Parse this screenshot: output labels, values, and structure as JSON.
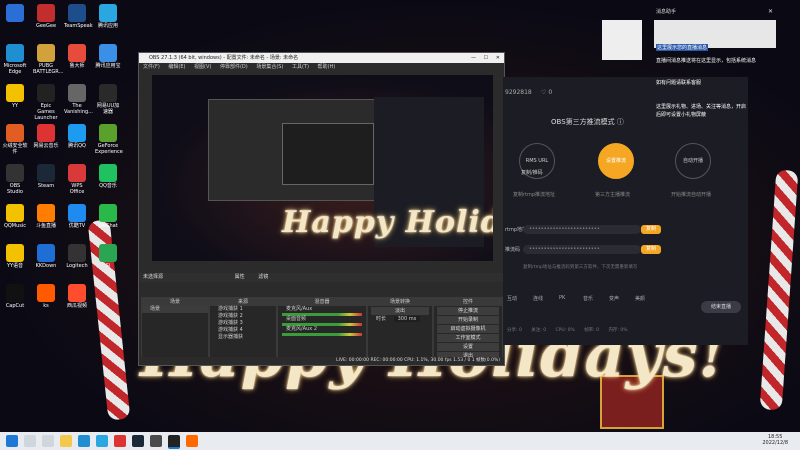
{
  "desktop": {
    "icons": [
      {
        "label": "",
        "color": "#2b6fd6"
      },
      {
        "label": "GeeGee",
        "color": "#c22d2d"
      },
      {
        "label": "TeamSpeak",
        "color": "#1e4d8c"
      },
      {
        "label": "腾讯应用",
        "color": "#2aa6e0"
      },
      {
        "label": "Microsoft Edge",
        "color": "#1f8fd1"
      },
      {
        "label": "PUBG BATTLEGR...",
        "color": "#d1a13b"
      },
      {
        "label": "鲁大师",
        "color": "#e64b3b"
      },
      {
        "label": "腾讯应用宝",
        "color": "#3b8fe6"
      },
      {
        "label": "YY",
        "color": "#f2c200"
      },
      {
        "label": "Epic Games Launcher",
        "color": "#222"
      },
      {
        "label": "The Vanishing...",
        "color": "#666"
      },
      {
        "label": "网易UU加速器",
        "color": "#2a2a2a"
      },
      {
        "label": "火绒安全软件",
        "color": "#e25d21"
      },
      {
        "label": "网易云音乐",
        "color": "#d33"
      },
      {
        "label": "腾讯QQ",
        "color": "#1d9bf0"
      },
      {
        "label": "GeForce Experience",
        "color": "#5aa02c"
      },
      {
        "label": "OBS Studio",
        "color": "#333"
      },
      {
        "label": "Steam",
        "color": "#1b2838"
      },
      {
        "label": "WPS Office",
        "color": "#d83a3a"
      },
      {
        "label": "QQ音乐",
        "color": "#1fc160"
      },
      {
        "label": "QQMusic",
        "color": "#f2c200"
      },
      {
        "label": "斗鱼直播",
        "color": "#ff7d00"
      },
      {
        "label": "优酷TV",
        "color": "#1f8bf0"
      },
      {
        "label": "WeChat",
        "color": "#2bb84b"
      },
      {
        "label": "YY语音",
        "color": "#f2c200"
      },
      {
        "label": "KKDown",
        "color": "#1e6ed6"
      },
      {
        "label": "Logitech",
        "color": "#333"
      },
      {
        "label": "Si",
        "color": "#2aa652"
      },
      {
        "label": "CapCut",
        "color": "#111"
      },
      {
        "label": "ks",
        "color": "#ff5a00"
      },
      {
        "label": "西瓜视频",
        "color": "#ff4d2e"
      }
    ],
    "greeting_big": "Happy Holidays!",
    "greeting_small": "Happy Holidays!"
  },
  "obs": {
    "title": "OBS 27.1.3 (64 bit, windows) - 配置文件: 未命名 - 场景: 未命名",
    "menu": [
      "文件(F)",
      "编辑(E)",
      "视图(V)",
      "停靠部件(D)",
      "场景集合(S)",
      "工具(T)",
      "帮助(H)"
    ],
    "scene_bar": [
      "未选择源",
      "属性",
      "滤镜"
    ],
    "docks": {
      "scenes": {
        "title": "场景",
        "items": [
          "场景"
        ]
      },
      "sources": {
        "title": "来源",
        "items": [
          "游戏捕获 1",
          "游戏捕获 2",
          "游戏捕获 3",
          "游戏捕获 4",
          "显示器捕获"
        ]
      },
      "mixer": {
        "title": "混音器",
        "items": [
          "麦克风/Aux",
          "桌面音频",
          "麦克风/Aux 2"
        ],
        "levels": [
          "0.0 dB",
          "-2.4 dB",
          "0.0 dB"
        ]
      },
      "transitions": {
        "title": "场景转换",
        "type": "淡出",
        "duration_label": "时长",
        "duration": "300 ms"
      },
      "controls": {
        "title": "控件",
        "buttons": [
          "停止推流",
          "开始录制",
          "启动虚拟摄像机",
          "工作室模式",
          "设置",
          "退出"
        ]
      }
    },
    "status": "LIVE: 00:00:00   REC: 00:00:00   CPU: 1.1%, 30.00 fps   1.53 / 0 1 帧数(0.0%)"
  },
  "live_app": {
    "room_id": "9292818",
    "viewers": "0",
    "mode_title": "OBS第三方推流模式",
    "steps": [
      {
        "num": "1",
        "label": "RMS URL",
        "sub": "复制/推码",
        "desc": "复制rtmp推流地址"
      },
      {
        "num": "2",
        "label": "设置推流",
        "sub": "",
        "desc": "第三方主播推流"
      },
      {
        "num": "3",
        "label": "自动开播",
        "sub": "",
        "desc": "开始推流自动开播"
      }
    ],
    "fields": [
      {
        "label": "rtmp地址",
        "value": "••••••••••••••••••••••••",
        "btn": "复制"
      },
      {
        "label": "推流码",
        "value": "••••••••••••••••••••••••",
        "btn": "复制"
      }
    ],
    "hint": "复制rtmp地址与推流码到第三方软件，下次无需重新填写",
    "bottom_tools": [
      "互动",
      "连线",
      "PK",
      "音乐",
      "变声",
      "美颜"
    ],
    "end_button": "结束直播",
    "stats": [
      "分享: 0",
      "关注: 0",
      "CPU: 0%",
      "帧率: 0",
      "内存: 0%"
    ]
  },
  "notifications": {
    "header": "消息助手",
    "lines": [
      "这里展示您的直播消息",
      "直播间消息推送将在这里显示，包括系统消息",
      "如有问题请联系客服",
      "这里展示礼物、进场、关注等消息，开启",
      "后即可设置小礼物屏蔽"
    ]
  },
  "taskbar": {
    "time": "18:55",
    "date": "2022/12/8"
  }
}
